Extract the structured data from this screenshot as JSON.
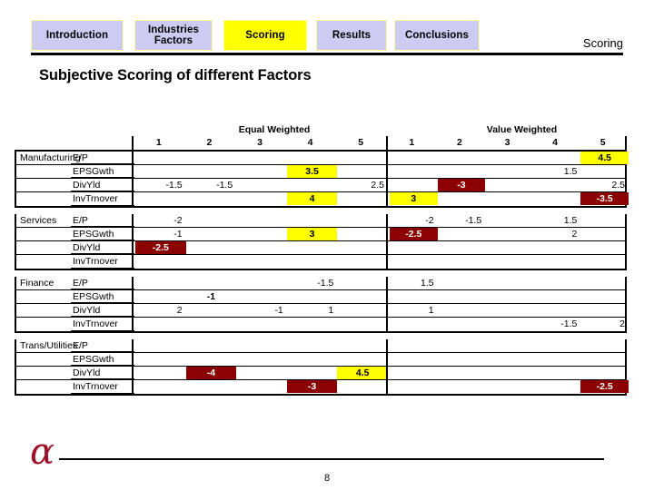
{
  "nav": {
    "tabs": [
      {
        "id": "introduction",
        "label": "Introduction",
        "active": false
      },
      {
        "id": "industries",
        "label": "Industries\nFactors",
        "label_line1": "Industries",
        "label_line2": "Factors",
        "active": false
      },
      {
        "id": "scoring",
        "label": "Scoring",
        "active": true
      },
      {
        "id": "results",
        "label": "Results",
        "active": false
      },
      {
        "id": "conclusions",
        "label": "Conclusions",
        "active": false
      }
    ],
    "active_tab_color": "#FFFF00",
    "inactive_tab_color": "#CCCCF2",
    "tab_border_color": "#FFFF99"
  },
  "header": {
    "right_label": "Scoring"
  },
  "slide": {
    "title": "Subjective Scoring of different Factors"
  },
  "colors": {
    "highlight_positive": "#FFFF00",
    "highlight_negative": "#8B0000",
    "text": "#000000",
    "alpha_logo": "#9B1128"
  },
  "table": {
    "group_headers": [
      "Equal Weighted",
      "Value Weighted"
    ],
    "column_numbers": [
      "1",
      "2",
      "3",
      "4",
      "5"
    ],
    "factors": [
      "E/P",
      "EPSGwth",
      "DivYld",
      "InvTrnover"
    ],
    "industries": [
      "Manufacturing",
      "Services",
      "Finance",
      "Trans/Utilities"
    ],
    "blocks": [
      {
        "industry": "Manufacturing",
        "rows": [
          {
            "factor": "E/P",
            "equal": [
              null,
              null,
              null,
              null,
              null
            ],
            "value": [
              null,
              null,
              null,
              null,
              {
                "text": "4.5",
                "style": "hl-yellow"
              }
            ]
          },
          {
            "factor": "EPSGwth",
            "equal": [
              null,
              null,
              null,
              {
                "text": "3.5",
                "style": "hl-yellow"
              },
              null
            ],
            "value": [
              null,
              null,
              null,
              {
                "text": "1.5",
                "style": "plain"
              },
              null
            ]
          },
          {
            "factor": "DivYld",
            "equal": [
              {
                "text": "-1.5",
                "style": "plain"
              },
              {
                "text": "-1.5",
                "style": "plain"
              },
              null,
              null,
              {
                "text": "2.5",
                "style": "plain"
              }
            ],
            "value": [
              null,
              {
                "text": "-3",
                "style": "hl-red"
              },
              null,
              null,
              {
                "text": "2.5",
                "style": "plain"
              }
            ]
          },
          {
            "factor": "InvTrnover",
            "equal": [
              null,
              null,
              null,
              {
                "text": "4",
                "style": "hl-yellow"
              },
              null
            ],
            "value": [
              {
                "text": "3",
                "style": "hl-yellow"
              },
              null,
              null,
              null,
              {
                "text": "-3.5",
                "style": "hl-red"
              }
            ]
          }
        ]
      },
      {
        "industry": "Services",
        "rows": [
          {
            "factor": "E/P",
            "equal": [
              {
                "text": "-2",
                "style": "plain"
              },
              null,
              null,
              null,
              null
            ],
            "value": [
              {
                "text": "-2",
                "style": "plain"
              },
              {
                "text": "-1.5",
                "style": "plain"
              },
              null,
              {
                "text": "1.5",
                "style": "plain"
              },
              null
            ]
          },
          {
            "factor": "EPSGwth",
            "equal": [
              {
                "text": "-1",
                "style": "plain"
              },
              null,
              null,
              {
                "text": "3",
                "style": "hl-yellow"
              },
              null
            ],
            "value": [
              {
                "text": "-2.5",
                "style": "hl-red"
              },
              null,
              null,
              {
                "text": "2",
                "style": "plain"
              },
              null
            ]
          },
          {
            "factor": "DivYld",
            "equal": [
              {
                "text": "-2.5",
                "style": "hl-red"
              },
              null,
              null,
              null,
              null
            ],
            "value": [
              null,
              null,
              null,
              null,
              null
            ]
          },
          {
            "factor": "InvTrnover",
            "equal": [
              null,
              null,
              null,
              null,
              null
            ],
            "value": [
              null,
              null,
              null,
              null,
              null
            ]
          }
        ]
      },
      {
        "industry": "Finance",
        "rows": [
          {
            "factor": "E/P",
            "equal": [
              null,
              null,
              null,
              {
                "text": "-1.5",
                "style": "plain"
              },
              null
            ],
            "value": [
              {
                "text": "1.5",
                "style": "plain"
              },
              null,
              null,
              null,
              null
            ]
          },
          {
            "factor": "EPSGwth",
            "equal": [
              null,
              {
                "text": "-1",
                "style": "bold-plain"
              },
              null,
              null,
              null
            ],
            "value": [
              null,
              null,
              null,
              null,
              null
            ]
          },
          {
            "factor": "DivYld",
            "equal": [
              {
                "text": "2",
                "style": "plain"
              },
              null,
              {
                "text": "-1",
                "style": "plain"
              },
              {
                "text": "1",
                "style": "plain"
              },
              null
            ],
            "value": [
              {
                "text": "1",
                "style": "plain"
              },
              null,
              null,
              null,
              null
            ]
          },
          {
            "factor": "InvTrnover",
            "equal": [
              null,
              null,
              null,
              null,
              null
            ],
            "value": [
              null,
              null,
              null,
              {
                "text": "-1.5",
                "style": "plain"
              },
              {
                "text": "2",
                "style": "plain"
              }
            ]
          }
        ]
      },
      {
        "industry": "Trans/Utilities",
        "rows": [
          {
            "factor": "E/P",
            "equal": [
              null,
              null,
              null,
              null,
              null
            ],
            "value": [
              null,
              null,
              null,
              null,
              null
            ]
          },
          {
            "factor": "EPSGwth",
            "equal": [
              null,
              null,
              null,
              null,
              null
            ],
            "value": [
              null,
              null,
              null,
              null,
              null
            ]
          },
          {
            "factor": "DivYld",
            "equal": [
              null,
              {
                "text": "-4",
                "style": "hl-red"
              },
              null,
              null,
              {
                "text": "4.5",
                "style": "hl-yellow"
              }
            ],
            "value": [
              null,
              null,
              null,
              null,
              null
            ]
          },
          {
            "factor": "InvTrnover",
            "equal": [
              null,
              null,
              null,
              {
                "text": "-3",
                "style": "hl-red"
              },
              null
            ],
            "value": [
              null,
              null,
              null,
              null,
              {
                "text": "-2.5",
                "style": "hl-red"
              }
            ]
          }
        ]
      }
    ]
  },
  "footer": {
    "logo_glyph": "α",
    "page_number": "8"
  }
}
